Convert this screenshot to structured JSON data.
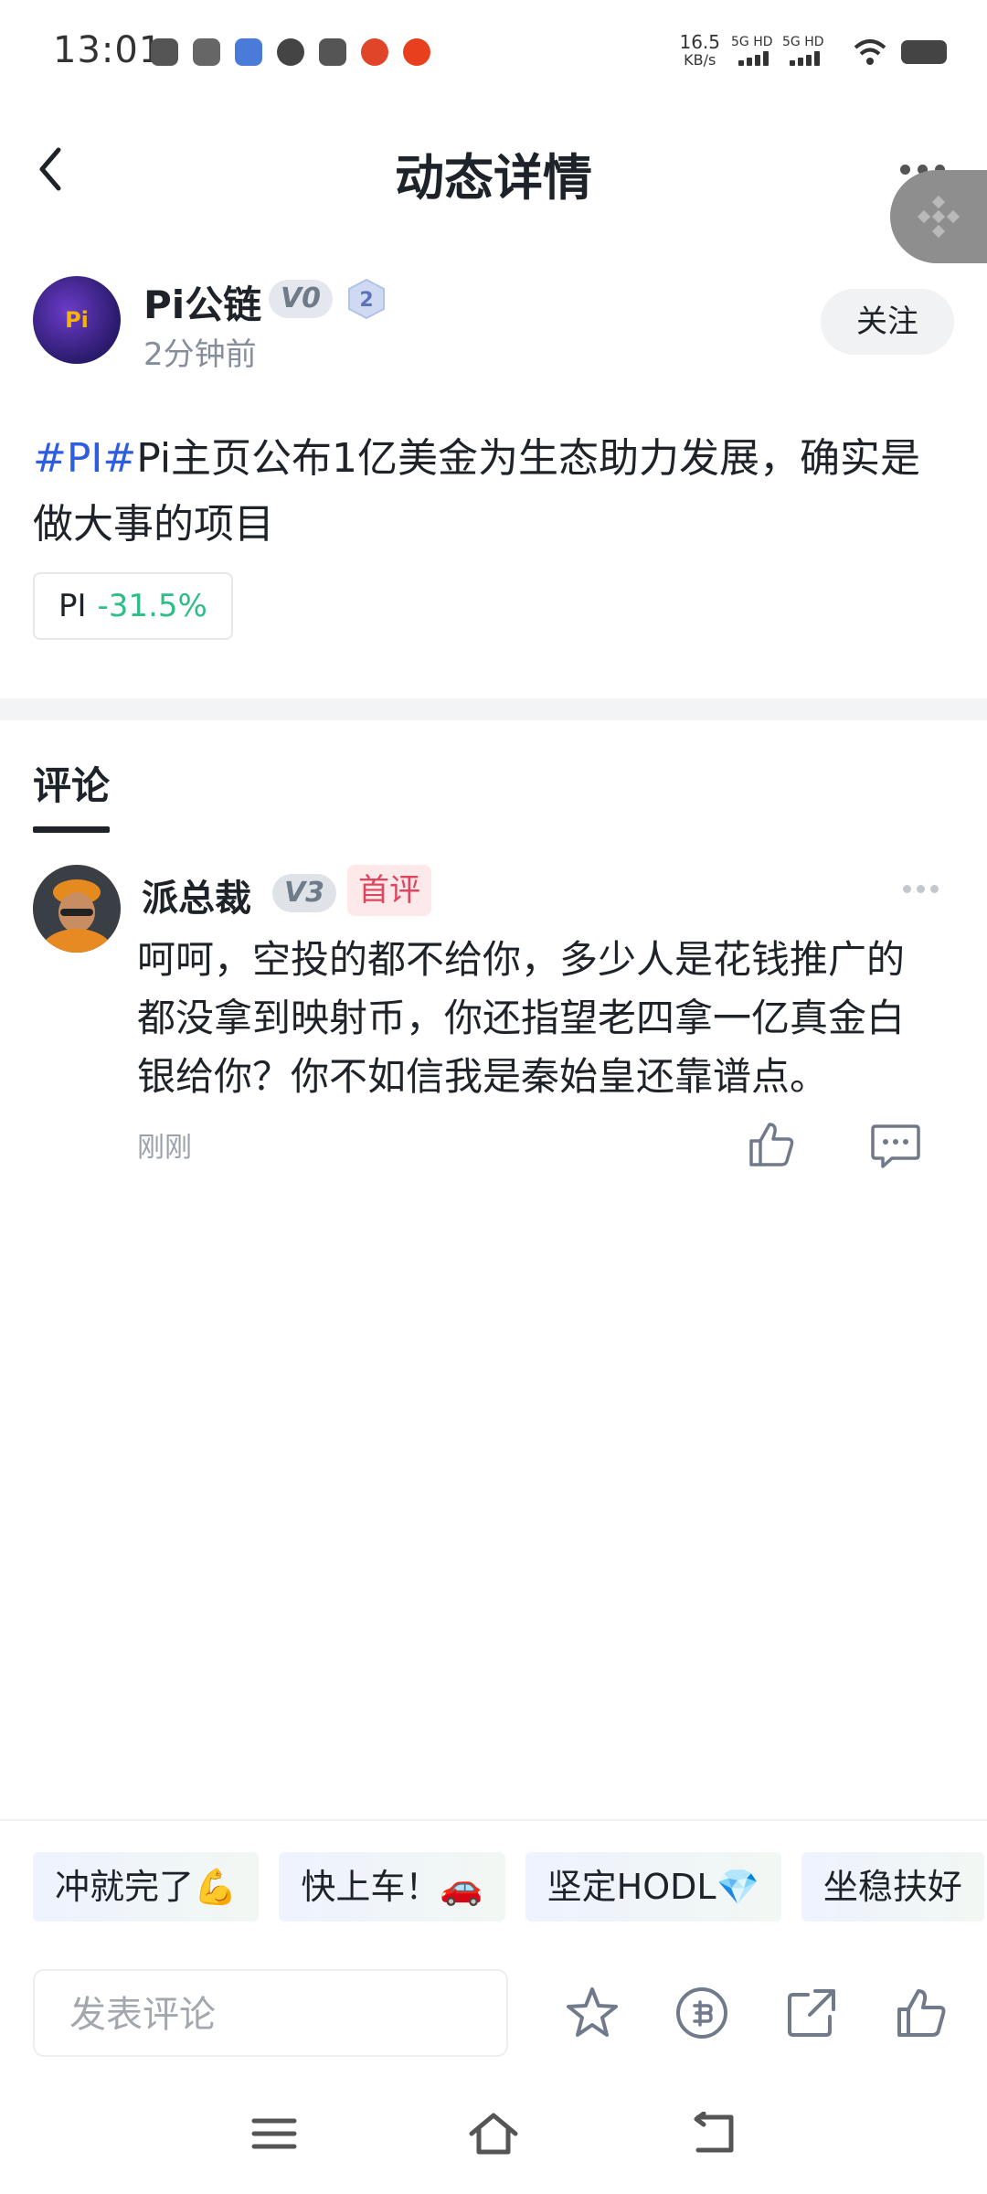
{
  "status_bar": {
    "time": "13:01",
    "net_speed_value": "16.5",
    "net_speed_unit": "KB/s",
    "signal1_label": "5G HD",
    "signal2_label": "5G HD"
  },
  "header": {
    "title": "动态详情"
  },
  "post": {
    "author": "Pi公链",
    "author_level": "V0",
    "rank_badge": "2",
    "time": "2分钟前",
    "follow_label": "关注",
    "hashtag": "#PI#",
    "body": "Pi主页公布1亿美金为生态助力发展，确实是做大事的项目",
    "coin": {
      "symbol": "PI",
      "change": "-31.5%"
    },
    "avatar_text": "Pi"
  },
  "comments": {
    "tab_label": "评论",
    "items": [
      {
        "name": "派总裁",
        "level": "V3",
        "badge": "首评",
        "text": "呵呵，空投的都不给你，多少人是花钱推广的都没拿到映射币，你还指望老四拿一亿真金白银给你？你不如信我是秦始皇还靠谱点。",
        "time": "刚刚"
      }
    ]
  },
  "quick_replies": [
    "冲就完了💪",
    "快上车！🚗",
    "坚定HODL💎",
    "坐稳扶好"
  ],
  "composer": {
    "placeholder": "发表评论"
  },
  "colors": {
    "accent_tag": "#2f5de0",
    "positive_change": "#2ebd85",
    "first_badge": "#e0455f"
  },
  "icons": [
    "back-icon",
    "more-icon",
    "binance-icon",
    "star-icon",
    "tip-icon",
    "share-icon",
    "like-icon",
    "reply-icon",
    "menu-icon",
    "home-icon",
    "back-nav-icon"
  ]
}
